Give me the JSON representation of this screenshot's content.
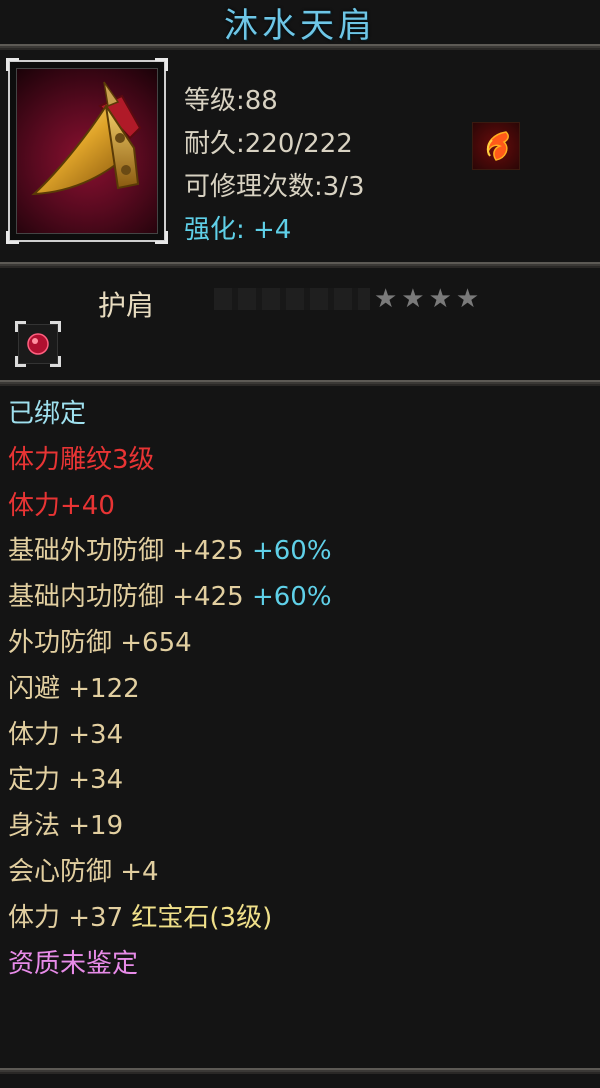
{
  "item": {
    "name": "沐水天肩",
    "slot_type": "护肩",
    "stars": "★★★★"
  },
  "stats": {
    "level": "等级:88",
    "durability": "耐久:220/222",
    "repair": "可修理次数:3/3",
    "enhance": "强化: +4"
  },
  "attributes": {
    "bound": "已绑定",
    "engrave": "体力雕纹3级",
    "engrave_bonus": "体力+40",
    "base_ext_def": {
      "label": "基础外功防御 +425",
      "pct": "+60%"
    },
    "base_int_def": {
      "label": "基础内功防御 +425",
      "pct": "+60%"
    },
    "ext_def": "外功防御 +654",
    "dodge": "闪避 +122",
    "stamina": "体力 +34",
    "focus": "定力 +34",
    "agility": "身法 +19",
    "crit_def": "会心防御 +4",
    "gem_stat": "体力 +37",
    "gem_name": "红宝石(3级)",
    "quality": "资质未鉴定"
  },
  "colors": {
    "title": "#6ec6e6",
    "enhance": "#5fd0e8",
    "red": "#e83434",
    "attr": "#e2cfa0",
    "quality": "#e78be8"
  },
  "icons": {
    "item": "shoulder-pad-icon",
    "element": "fire-swirl-icon",
    "gem_socket": "ruby-gem-icon"
  }
}
